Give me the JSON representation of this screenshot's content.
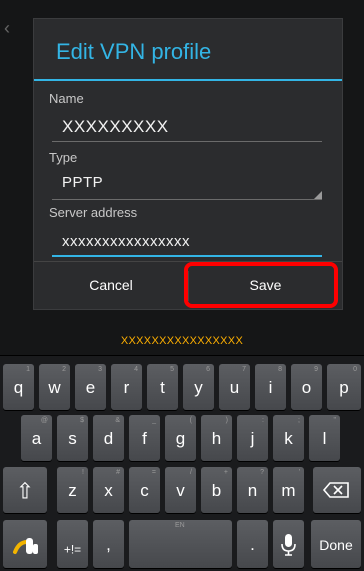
{
  "dialog": {
    "title": "Edit VPN profile",
    "fields": [
      {
        "label": "Name",
        "value": "XXXXXXXXX"
      },
      {
        "label": "Type",
        "value": "PPTP"
      },
      {
        "label": "Server address",
        "value": "xxxxxxxxxxxxxxxx"
      }
    ],
    "cancel_label": "Cancel",
    "save_label": "Save"
  },
  "suggestion": "XXXXXXXXXXXXXXXX",
  "keyboard": {
    "row1": [
      {
        "main": "q",
        "sub": "1"
      },
      {
        "main": "w",
        "sub": "2"
      },
      {
        "main": "e",
        "sub": "3"
      },
      {
        "main": "r",
        "sub": "4"
      },
      {
        "main": "t",
        "sub": "5"
      },
      {
        "main": "y",
        "sub": "6"
      },
      {
        "main": "u",
        "sub": "7"
      },
      {
        "main": "i",
        "sub": "8"
      },
      {
        "main": "o",
        "sub": "9"
      },
      {
        "main": "p",
        "sub": "0"
      }
    ],
    "row2": [
      {
        "main": "a",
        "sub": "@"
      },
      {
        "main": "s",
        "sub": "$"
      },
      {
        "main": "d",
        "sub": "&"
      },
      {
        "main": "f",
        "sub": "_"
      },
      {
        "main": "g",
        "sub": "("
      },
      {
        "main": "h",
        "sub": ")"
      },
      {
        "main": "j",
        "sub": ":"
      },
      {
        "main": "k",
        "sub": ";"
      },
      {
        "main": "l",
        "sub": "\""
      }
    ],
    "row3": [
      {
        "main": "z",
        "sub": "!"
      },
      {
        "main": "x",
        "sub": "#"
      },
      {
        "main": "c",
        "sub": "="
      },
      {
        "main": "v",
        "sub": "/"
      },
      {
        "main": "b",
        "sub": "+"
      },
      {
        "main": "n",
        "sub": "?"
      },
      {
        "main": "m",
        "sub": "'"
      }
    ],
    "shift_glyph": "⇧",
    "symbols_label": "+!=",
    "comma_label": ",",
    "space_label": "EN",
    "period_label": ".",
    "done_label": "Done"
  }
}
